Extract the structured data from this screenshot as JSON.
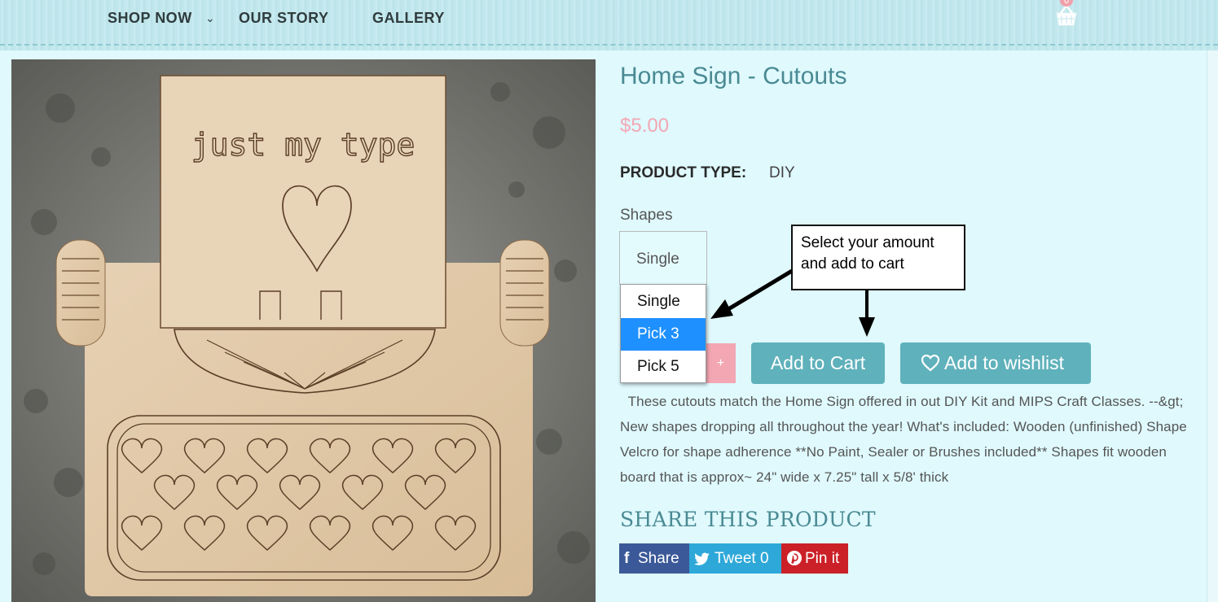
{
  "nav": {
    "items": [
      {
        "label": "SHOP NOW",
        "has_dropdown": true
      },
      {
        "label": "OUR STORY"
      },
      {
        "label": "GALLERY"
      }
    ],
    "cart_count": "0",
    "cart_icon": "basket-icon"
  },
  "product": {
    "image_text": "just my type",
    "title": "Home Sign - Cutouts",
    "price": "$5.00",
    "type_label": "PRODUCT TYPE:",
    "type_value": "DIY",
    "option_label": "Shapes",
    "selected_option": "Single",
    "options": [
      "Single",
      "Pick 3",
      "Pick 5"
    ],
    "highlighted_option_index": 1,
    "quantity_plus": "+",
    "add_to_cart": "Add to Cart",
    "add_to_wishlist": "Add to wishlist",
    "description": "These cutouts match the Home Sign offered in out DIY Kit and MIPS Craft Classes. --&gt; New shapes dropping all throughout the year! What's included: Wooden (unfinished) Shape Velcro for shape adherence **No Paint, Sealer or Brushes included** Shapes fit wooden board that is approx~ 24\" wide x 7.25\" tall x 5/8' thick"
  },
  "share": {
    "title": "SHARE THIS PRODUCT",
    "facebook": "Share",
    "twitter": "Tweet 0",
    "pinterest": "Pin it"
  },
  "callout": {
    "text": "Select your amount and add to cart"
  },
  "colors": {
    "accent": "#5fb1bb",
    "title": "#4a8a93",
    "price": "#f3a7b3",
    "background": "#dff9fd",
    "facebook": "#3b5998",
    "twitter": "#2ea8d8",
    "pinterest": "#cb2027"
  }
}
